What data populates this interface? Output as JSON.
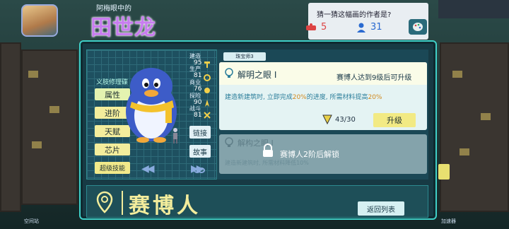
{
  "header": {
    "subtitle": "阿梅眼中的",
    "name": "田世龙",
    "question": "猜一猜这幅画的作者是?",
    "stat_red": "5",
    "stat_blue": "31"
  },
  "left_panel": {
    "section_label": "义肢修理碟",
    "tabs": [
      "属性",
      "进阶",
      "天赋",
      "芯片"
    ],
    "skill_button": "超级技能"
  },
  "attributes": [
    {
      "label": "建造",
      "value": "95"
    },
    {
      "label": "生产",
      "value": "81"
    },
    {
      "label": "商业",
      "value": "76"
    },
    {
      "label": "探险",
      "value": "90"
    },
    {
      "label": "战斗",
      "value": "81"
    }
  ],
  "side_buttons": {
    "link": "链接",
    "story": "故事"
  },
  "badge": "珠宝师3",
  "card1": {
    "title": "解明之眼 I",
    "condition": "赛博人达到9级后可升级",
    "desc_pre": "建造新建筑时, 立即完成",
    "desc_hl1": "20%",
    "desc_mid": "的进度, 所需材料提高",
    "desc_hl2": "20%",
    "progress": "43/30",
    "upgrade": "升级"
  },
  "card2": {
    "title": "解构之眼 I",
    "lock_text": "赛博人2阶后解锁",
    "desc": "建造新建筑时, 所需材料降低10%"
  },
  "bottom": {
    "name": "赛博人",
    "back": "返回列表"
  },
  "bottom_labels": {
    "left": "空间站",
    "right": "加速器"
  },
  "colors": {
    "accent": "#3fd0c8",
    "name_purple": "#c87cf0",
    "button_yellow": "#f3ed9c",
    "highlight": "#d08a20"
  }
}
